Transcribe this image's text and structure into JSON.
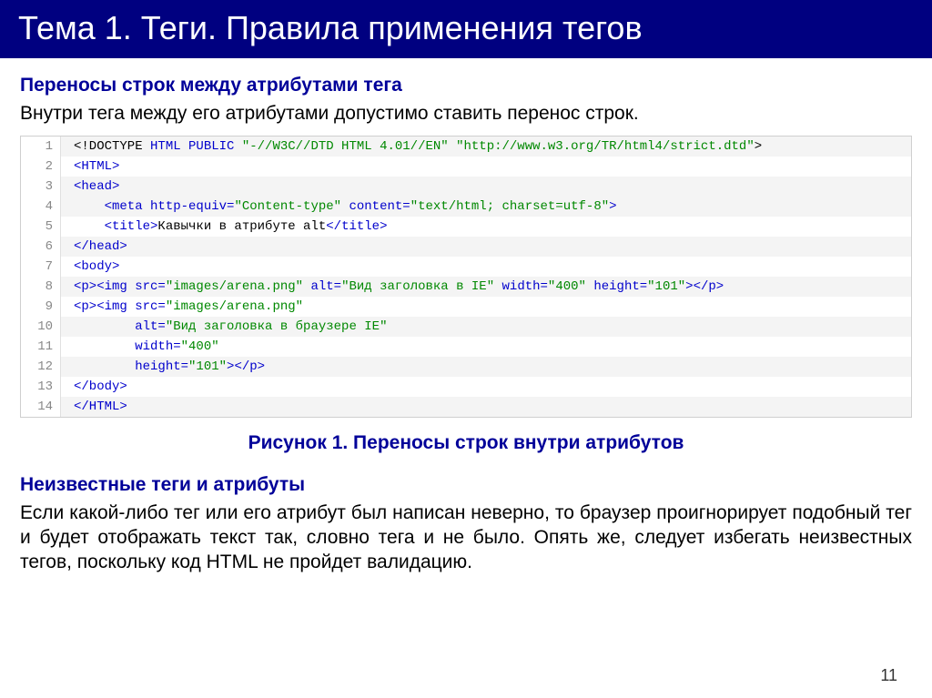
{
  "title": "Тема 1. Теги. Правила применения тегов",
  "section1": {
    "heading": "Переносы строк между атрибутами тега",
    "text": "Внутри тега между его атрибутами допустимо ставить перенос строк."
  },
  "figure_caption": "Рисунок 1. Переносы строк внутри атрибутов",
  "section2": {
    "heading": "Неизвестные теги и атрибуты",
    "text": "Если какой-либо тег или его атрибут был написан неверно, то браузер проигнорирует подобный тег и будет отображать текст так, словно тега и не было. Опять же, следует избегать неизвестных тегов, поскольку код HTML не пройдет валидацию."
  },
  "page_number": "11",
  "code_lines": {
    "l1a": "<!DOCTYPE ",
    "l1b": "HTML PUBLIC ",
    "l1c": "\"-//W3C//DTD HTML 4.01//EN\" \"http://www.w3.org/TR/html4/strict.dtd\"",
    "l1d": ">",
    "l2": "<HTML>",
    "l3": "<head>",
    "l4a": "    <meta ",
    "l4b": "http-equiv=",
    "l4c": "\"Content-type\"",
    "l4d": " content=",
    "l4e": "\"text/html; charset=utf-8\"",
    "l4f": ">",
    "l5a": "    <title>",
    "l5b": "Кавычки в атрибуте alt",
    "l5c": "</title>",
    "l6": "</head>",
    "l7": "<body>",
    "l8a": "<p><img ",
    "l8b": "src=",
    "l8c": "\"images/arena.png\"",
    "l8d": " alt=",
    "l8e": "\"Вид заголовка в IE\"",
    "l8f": " width=",
    "l8g": "\"400\"",
    "l8h": " height=",
    "l8i": "\"101\"",
    "l8j": "></p>",
    "l9a": "<p><img ",
    "l9b": "src=",
    "l9c": "\"images/arena.png\"",
    "l10a": "        alt=",
    "l10b": "\"Вид заголовка в браузере IE\"",
    "l11a": "        width=",
    "l11b": "\"400\"",
    "l12a": "        height=",
    "l12b": "\"101\"",
    "l12c": "></p>",
    "l13": "</body>",
    "l14": "</HTML>"
  },
  "line_numbers": [
    "1",
    "2",
    "3",
    "4",
    "5",
    "6",
    "7",
    "8",
    "9",
    "10",
    "11",
    "12",
    "13",
    "14"
  ]
}
